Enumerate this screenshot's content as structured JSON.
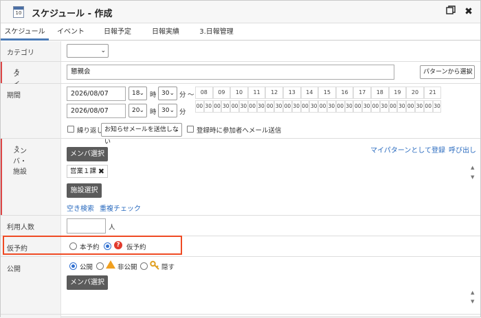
{
  "window": {
    "title": "スケジュール - 作成",
    "calendar_icon_number": "10"
  },
  "tabs": [
    {
      "label": "スケジュール",
      "active": true
    },
    {
      "label": "イベント",
      "active": false
    },
    {
      "label": "日報予定",
      "active": false
    },
    {
      "label": "日報実績",
      "active": false
    },
    {
      "label": "3.日報管理",
      "active": false
    }
  ],
  "form": {
    "category": {
      "label": "カテゴリ",
      "value": ""
    },
    "title": {
      "label": "タイトル",
      "required_mark": "*",
      "value": "懇親会",
      "pattern_select": "パターンから選択"
    },
    "period": {
      "label": "期間",
      "start_date": "2026/08/07",
      "start_hour": "18",
      "start_min": "30",
      "end_date": "2026/08/07",
      "end_hour": "20",
      "end_min": "30",
      "hour_unit": "時",
      "min_unit": "分",
      "tilde": "〜",
      "repeat_label": "繰り返し",
      "notify_select": "お知らせメールを送信しない",
      "register_mail_label": "登録時に参加者へメール送信"
    },
    "members": {
      "label": "メンバ・施設",
      "required_mark": "*",
      "member_select_button": "メンバ選択",
      "member_tag": "営業１課",
      "facility_select_button": "施設選択",
      "free_search_link": "空き検索",
      "dup_check_link": "重複チェック",
      "register_pattern_link": "マイパターンとして登録",
      "recall_link": "呼び出し"
    },
    "users_count": {
      "label": "利用人数",
      "value": "",
      "unit": "人"
    },
    "reservation": {
      "label": "仮予約",
      "option_confirmed": "本予約",
      "option_tentative": "仮予約",
      "selected": "仮予約"
    },
    "publish": {
      "label": "公開",
      "option_public": "公開",
      "option_private": "非公開",
      "option_hidden": "隠す",
      "selected": "公開",
      "member_select_button": "メンバ選択"
    }
  },
  "timeline": {
    "hours": [
      "08",
      "09",
      "10",
      "11",
      "12",
      "13",
      "14",
      "15",
      "16",
      "17",
      "18",
      "19",
      "20",
      "21"
    ],
    "minute_labels": [
      "00",
      "30"
    ]
  },
  "colors": {
    "accent": "#4a7ab5",
    "link": "#2a6bbf",
    "required": "#dd4444",
    "highlight_border": "#ef4a23",
    "dark_button": "#5b5b5b"
  }
}
